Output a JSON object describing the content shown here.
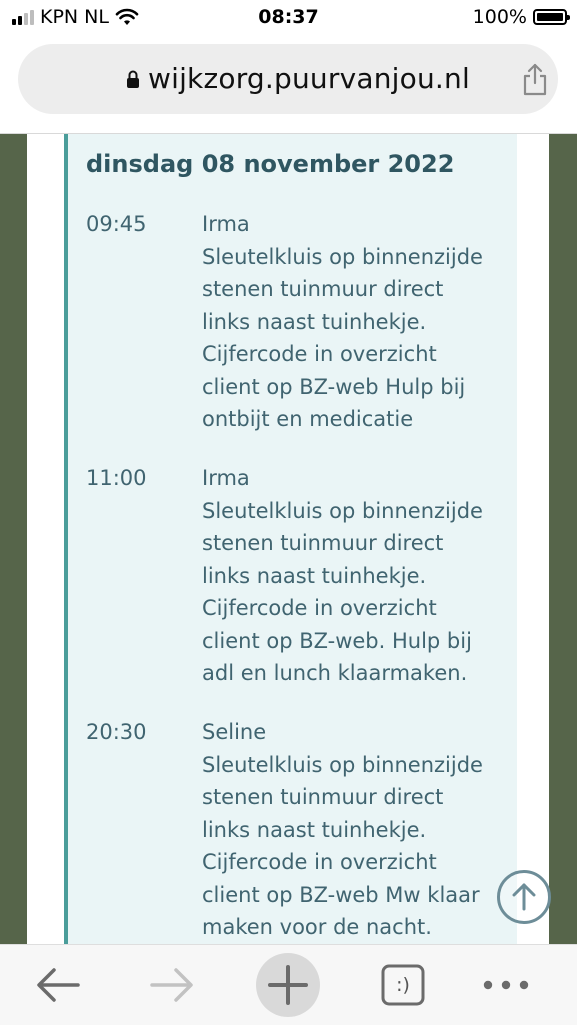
{
  "status_bar": {
    "carrier": "KPN NL",
    "time": "08:37",
    "battery": "100%"
  },
  "browser": {
    "url": "wijkzorg.puurvanjou.nl"
  },
  "schedule": {
    "date": "dinsdag 08 november 2022",
    "appointments": [
      {
        "time": "09:45",
        "lines": [
          "Irma",
          "Sleutelkluis op binnenzijde",
          "stenen tuinmuur direct",
          "links naast tuinhekje.",
          "Cijfercode in overzicht",
          "client op BZ-web Hulp bij",
          "ontbijt en medicatie"
        ]
      },
      {
        "time": "11:00",
        "lines": [
          "Irma",
          "Sleutelkluis op binnenzijde",
          "stenen tuinmuur direct",
          "links naast tuinhekje.",
          "Cijfercode in overzicht",
          "client op BZ-web. Hulp bij",
          "adl en lunch klaarmaken."
        ]
      },
      {
        "time": "20:30",
        "lines": [
          "Seline",
          "Sleutelkluis op binnenzijde",
          "stenen tuinmuur direct",
          "links naast tuinhekje.",
          "Cijfercode in overzicht",
          "client op BZ-web Mw klaar",
          "maken voor de nacht."
        ]
      }
    ]
  },
  "toolbar": {
    "icons": [
      "back-arrow-icon",
      "forward-arrow-icon",
      "new-tab-plus-icon",
      "tabs-icon",
      "more-icon"
    ],
    "tabs_label": ":)"
  },
  "colors": {
    "card_background": "#eaf5f6",
    "card_accent": "#4a9d9a",
    "text": "#406470",
    "title": "#2f5661",
    "side_background": "#56654a"
  }
}
